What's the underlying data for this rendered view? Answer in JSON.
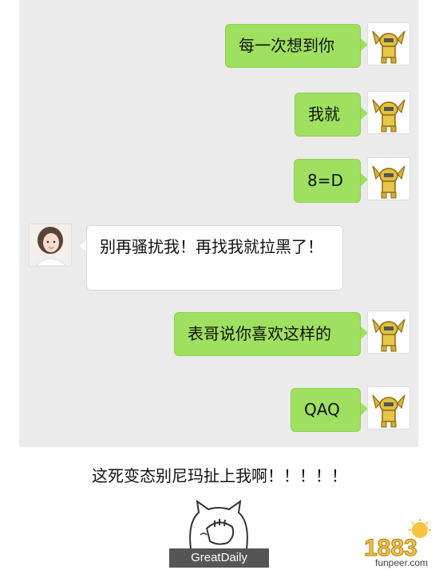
{
  "messages": [
    {
      "side": "out",
      "text": "每一次想到你"
    },
    {
      "side": "out",
      "text": "我就"
    },
    {
      "side": "out",
      "text": "8=D"
    },
    {
      "side": "in",
      "text": "别再骚扰我！再找我就拉黑了！"
    },
    {
      "side": "out",
      "text": "表哥说你喜欢这样的"
    },
    {
      "side": "out",
      "text": "QAQ"
    }
  ],
  "caption": "这死变态别尼玛扯上我啊！！！！！",
  "watermark": "GreatDaily",
  "site_logo": {
    "number": "1883",
    "domain": "funpeer.com"
  },
  "colors": {
    "out_bubble": "#9fe060",
    "in_bubble": "#ffffff",
    "chat_bg": "#ebebeb"
  },
  "icons": {
    "sender_avatar": "golden-robot-avatar",
    "receiver_avatar": "girl-avatar"
  }
}
